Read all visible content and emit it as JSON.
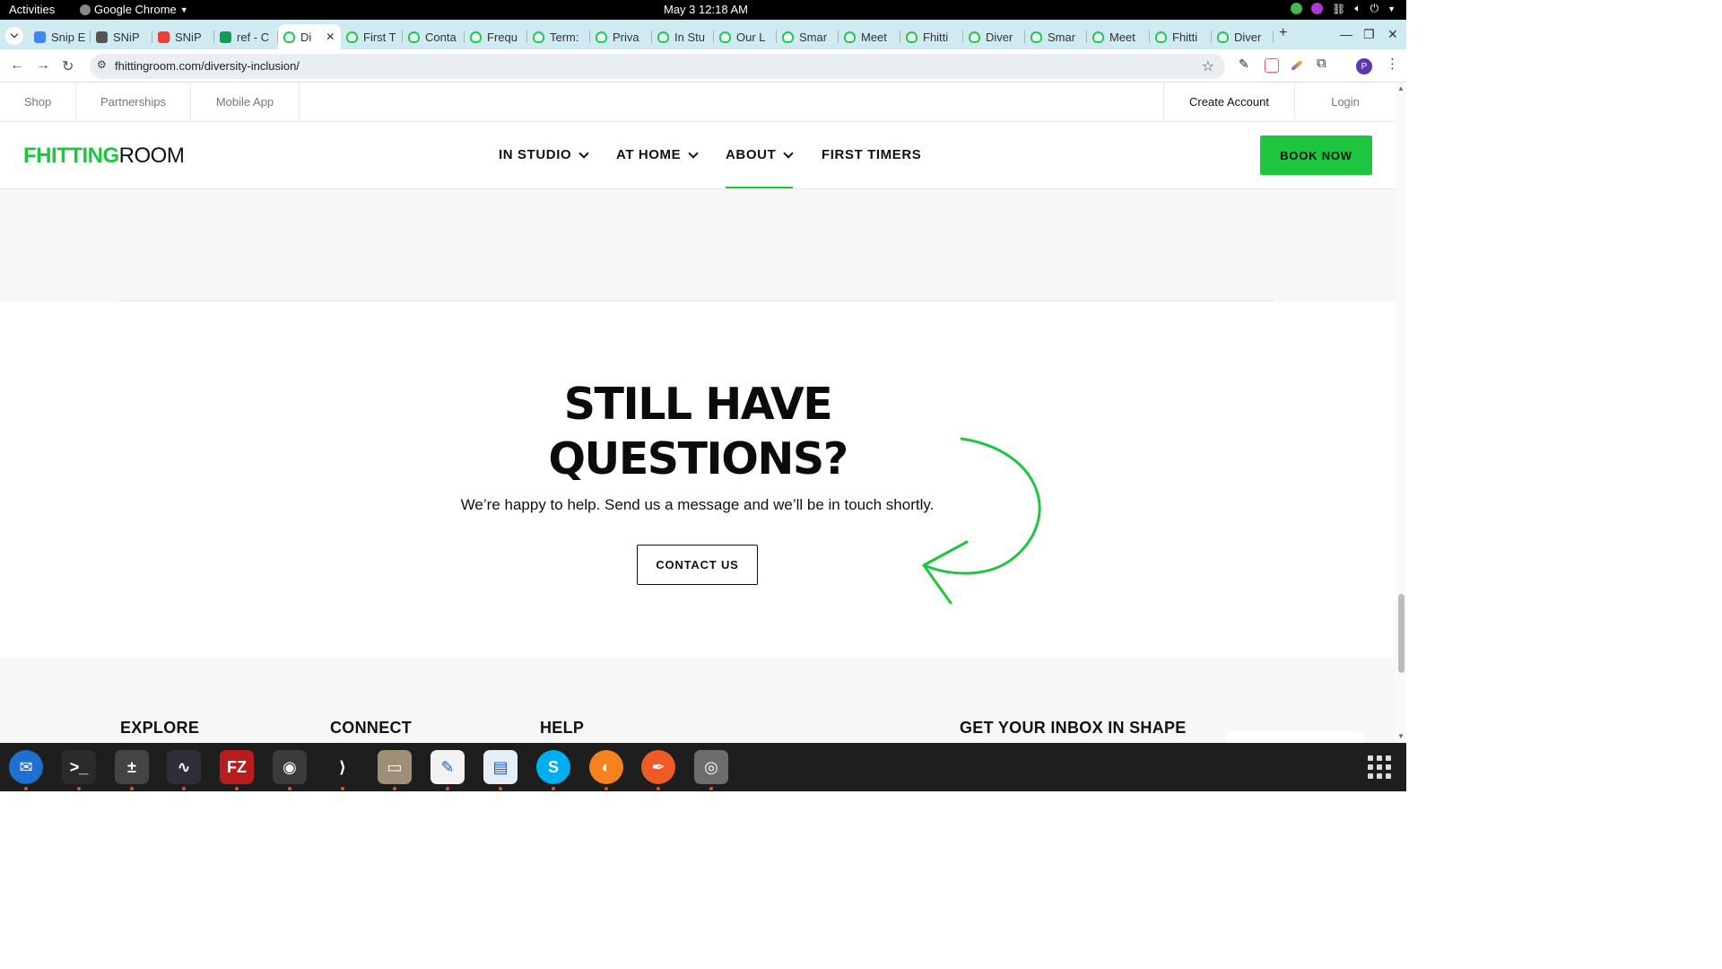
{
  "system_bar": {
    "activities": "Activities",
    "app_name": "Google Chrome",
    "clock": "May 3  12:18 AM"
  },
  "browser": {
    "tabs": [
      {
        "label": "Snip E",
        "icon": "docs-icon",
        "color": "#4285f4"
      },
      {
        "label": "SNiP",
        "icon": "snip-icon",
        "color": "#555555"
      },
      {
        "label": "SNiP",
        "icon": "chrome-like-icon",
        "color": "#ea4335"
      },
      {
        "label": "ref - C",
        "icon": "sheets-icon",
        "color": "#0f9d58"
      },
      {
        "label": "Di",
        "icon": "fhitting-icon",
        "active": true
      },
      {
        "label": "First T",
        "icon": "fhitting-icon"
      },
      {
        "label": "Conta",
        "icon": "fhitting-icon"
      },
      {
        "label": "Frequ",
        "icon": "fhitting-icon"
      },
      {
        "label": "Term:",
        "icon": "fhitting-icon"
      },
      {
        "label": "Priva",
        "icon": "fhitting-icon"
      },
      {
        "label": "In Stu",
        "icon": "fhitting-icon"
      },
      {
        "label": "Our L",
        "icon": "fhitting-icon"
      },
      {
        "label": "Smar",
        "icon": "fhitting-icon"
      },
      {
        "label": "Meet",
        "icon": "fhitting-icon"
      },
      {
        "label": "Fhitti",
        "icon": "fhitting-icon"
      },
      {
        "label": "Diver",
        "icon": "fhitting-icon"
      },
      {
        "label": "Smar",
        "icon": "fhitting-icon"
      },
      {
        "label": "Meet",
        "icon": "fhitting-icon"
      },
      {
        "label": "Fhitti",
        "icon": "fhitting-icon"
      },
      {
        "label": "Diver",
        "icon": "fhitting-icon"
      }
    ],
    "new_tab": "+",
    "address": "fhittingroom.com/diversity-inclusion/",
    "profile_initial": "P"
  },
  "site": {
    "utility_links": [
      "Shop",
      "Partnerships",
      "Mobile App"
    ],
    "account_links": {
      "create": "Create Account",
      "login": "Login"
    },
    "logo": {
      "bold": "FHITTING",
      "light": "ROOM"
    },
    "nav": [
      {
        "label": "IN STUDIO",
        "dropdown": true
      },
      {
        "label": "AT HOME",
        "dropdown": true
      },
      {
        "label": "ABOUT",
        "dropdown": true,
        "active": true
      },
      {
        "label": "FIRST TIMERS",
        "dropdown": false
      }
    ],
    "book_now": "BOOK NOW",
    "cta": {
      "title_line1": "STILL HAVE",
      "title_line2": "QUESTIONS?",
      "subtitle": "We’re happy to help. Send us a message and we’ll be in touch shortly.",
      "button": "CONTACT US"
    },
    "footer_headings": [
      "EXPLORE",
      "CONNECT",
      "HELP",
      "GET YOUR INBOX IN SHAPE"
    ],
    "accent_color": "#1ec53f"
  },
  "dock": {
    "apps": [
      "thunderbird-icon",
      "terminal-icon",
      "calculator-icon",
      "system-monitor-icon",
      "filezilla-icon",
      "chrome-icon",
      "vscode-icon",
      "files-icon",
      "text-editor-icon",
      "document-viewer-icon",
      "skype-icon",
      "blender-like-icon",
      "postman-icon",
      "disk-icon"
    ]
  }
}
